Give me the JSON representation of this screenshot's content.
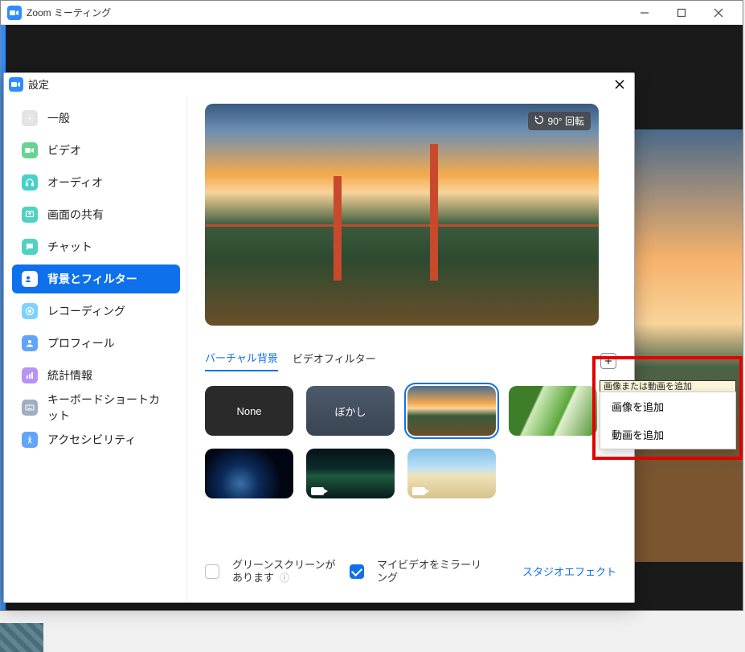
{
  "app": {
    "window_title": "Zoom ミーティング",
    "settings_title": "設定"
  },
  "sidebar": {
    "items": [
      {
        "label": "一般"
      },
      {
        "label": "ビデオ"
      },
      {
        "label": "オーディオ"
      },
      {
        "label": "画面の共有"
      },
      {
        "label": "チャット"
      },
      {
        "label": "背景とフィルター"
      },
      {
        "label": "レコーディング"
      },
      {
        "label": "プロフィール"
      },
      {
        "label": "統計情報"
      },
      {
        "label": "キーボードショートカット"
      },
      {
        "label": "アクセシビリティ"
      }
    ]
  },
  "preview": {
    "rotate_label": "90° 回転"
  },
  "tabs": {
    "virtual_bg": "バーチャル背景",
    "video_filter": "ビデオフィルター"
  },
  "thumbs": {
    "none": "None",
    "blur": "ぼかし"
  },
  "add_menu": {
    "tooltip": "画像または動画を追加",
    "image": "画像を追加",
    "video": "動画を追加"
  },
  "footer": {
    "green_screen": "グリーンスクリーンがあります",
    "mirror": "マイビデオをミラーリング",
    "studio": "スタジオエフェクト"
  }
}
